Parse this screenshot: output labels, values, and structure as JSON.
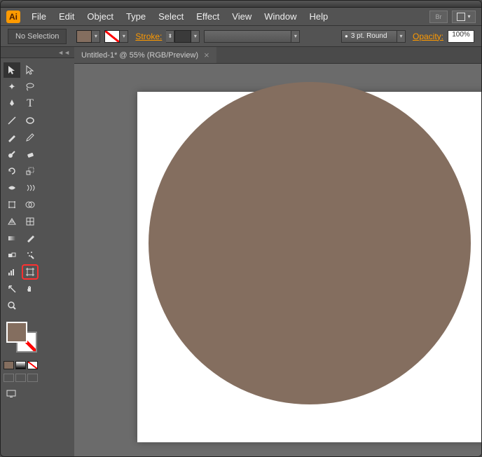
{
  "app_icon": "Ai",
  "menu": {
    "file": "File",
    "edit": "Edit",
    "object": "Object",
    "type": "Type",
    "select": "Select",
    "effect": "Effect",
    "view": "View",
    "window": "Window",
    "help": "Help",
    "br": "Br"
  },
  "control": {
    "selection": "No Selection",
    "stroke_label": "Stroke:",
    "stroke_weight": "",
    "brush_preset": "3 pt. Round",
    "opacity_label": "Opacity:",
    "opacity_value": "100%"
  },
  "document": {
    "tab_title": "Untitled-1* @ 55% (RGB/Preview)",
    "tab_close": "×"
  },
  "colors": {
    "fill": "#846e5f",
    "stroke": "none",
    "accent": "#ff9a00"
  },
  "tools": {
    "panel_collapse": "◄◄",
    "selection": "▲",
    "direct_selection": "△",
    "magic_wand": "✦",
    "lasso": "◯",
    "pen": "✒",
    "type": "T",
    "line": "╱",
    "ellipse": "◯",
    "brush": "✎",
    "pencil": "✐",
    "blob": "⬤",
    "eraser": "◧",
    "rotate": "↻",
    "scale": "⤢",
    "width": "⟷",
    "warp": "⎃",
    "free_transform": "⬚",
    "shape_builder": "◉",
    "perspective": "▦",
    "mesh": "⊞",
    "gradient": "▤",
    "eyedropper": "✓",
    "blend": "◑",
    "symbol_sprayer": "⚙",
    "graph": "⫍",
    "artboard": "⬚",
    "slice": "✂",
    "hand": "✋",
    "zoom": "🔍"
  }
}
